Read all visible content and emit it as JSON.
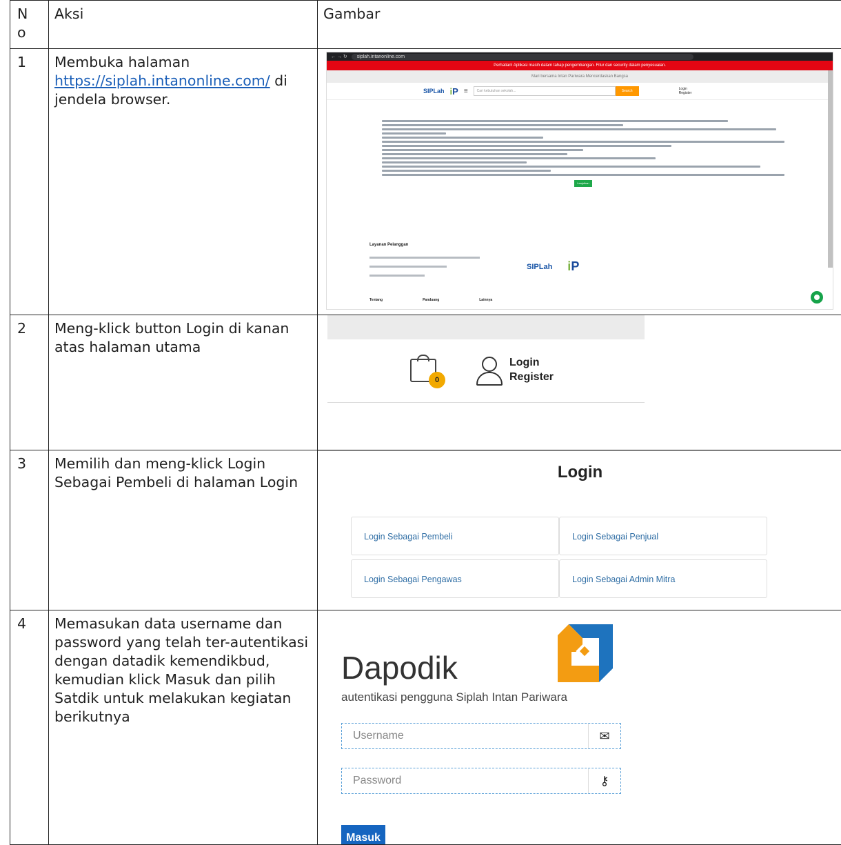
{
  "headers": {
    "no": "N\no",
    "aksi": "Aksi",
    "gambar": "Gambar"
  },
  "rows": [
    {
      "no": "1",
      "aksi_pre": "Membuka halaman ",
      "link": "https://siplah.intanonline.com/",
      "aksi_post": " di jendela browser."
    },
    {
      "no": "2",
      "aksi": "Meng-klick button Login di kanan atas halaman utama"
    },
    {
      "no": "3",
      "aksi": "Memilih dan meng-klick Login Sebagai Pembeli di halaman Login"
    },
    {
      "no": "4",
      "aksi": "Memasukan data username dan password yang telah ter-autentikasi dengan datadik kemendikbud, kemudian klick Masuk dan pilih Satdik untuk melakukan kegiatan berikutnya"
    }
  ],
  "shot1": {
    "url": "siplah.intanonline.com",
    "warning": "Perhatian! Aplikasi masih dalam tahap pengembangan. Fitur dan security dalam penyesuaian.",
    "tagline": "Mari bersama Intan Pariwara Mencerdaskan Bangsa",
    "logo1": "SIPLah",
    "logo2_a": "i",
    "logo2_b": "P",
    "search_placeholder": "Cari kebutuhan sekolah...",
    "search_button": "Search",
    "login": "Login",
    "register": "Register",
    "agree_button": "Lanjutkan",
    "layanan": "Layanan Pelanggan",
    "footer_cols": [
      "Tentang",
      "Panduang",
      "Lainnya"
    ]
  },
  "shot2": {
    "badge": "0",
    "login": "Login",
    "register": "Register"
  },
  "shot3": {
    "title": "Login",
    "tiles": [
      "Login Sebagai Pembeli",
      "Login Sebagai Penjual",
      "Login Sebagai Pengawas",
      "Login Sebagai Admin Mitra"
    ]
  },
  "shot4": {
    "brand": "Dapodik",
    "subtitle": "autentikasi pengguna Siplah Intan Pariwara",
    "username_placeholder": "Username",
    "password_placeholder": "Password",
    "submit": "Masuk"
  }
}
